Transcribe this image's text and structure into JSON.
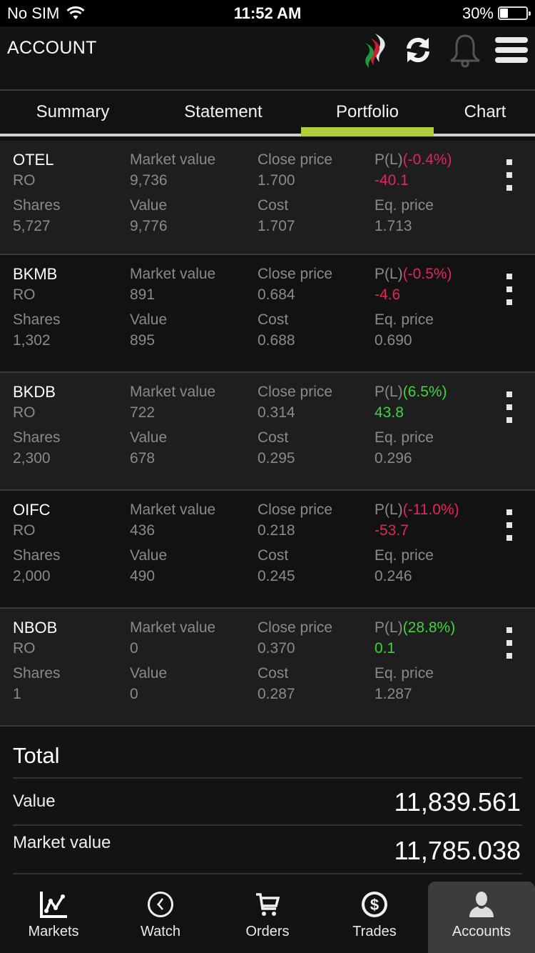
{
  "status_bar": {
    "carrier": "No SIM",
    "time": "11:52 AM",
    "battery_percent": "30%",
    "battery_level": 0.3
  },
  "header": {
    "title": "ACCOUNT",
    "icons": [
      "brand-logo-icon",
      "refresh-icon",
      "bell-icon",
      "hamburger-menu-icon"
    ]
  },
  "tabs": [
    {
      "label": "Summary",
      "active": false
    },
    {
      "label": "Statement",
      "active": false
    },
    {
      "label": "Portfolio",
      "active": true
    },
    {
      "label": "Chart",
      "active": false
    }
  ],
  "colors": {
    "accent": "#b2cb3a",
    "negative": "#e3245e",
    "positive": "#3ed43e",
    "label_grey": "#8a8a8a"
  },
  "labels": {
    "market_value": "Market value",
    "close_price": "Close price",
    "pl": "P(L)",
    "shares": "Shares",
    "value": "Value",
    "cost": "Cost",
    "eq_price": "Eq. price"
  },
  "holdings": [
    {
      "symbol": "OTEL",
      "currency": "RO",
      "market_value": "9,736",
      "close_price": "1.700",
      "pl_percent": "(-0.4%)",
      "pl_value": "-40.1",
      "trend": "neg",
      "shares": "5,727",
      "value": "9,776",
      "cost": "1.707",
      "eq_price": "1.713"
    },
    {
      "symbol": "BKMB",
      "currency": "RO",
      "market_value": "891",
      "close_price": "0.684",
      "pl_percent": "(-0.5%)",
      "pl_value": "-4.6",
      "trend": "neg",
      "shares": "1,302",
      "value": "895",
      "cost": "0.688",
      "eq_price": "0.690"
    },
    {
      "symbol": "BKDB",
      "currency": "RO",
      "market_value": "722",
      "close_price": "0.314",
      "pl_percent": "(6.5%)",
      "pl_value": "43.8",
      "trend": "pos",
      "shares": "2,300",
      "value": "678",
      "cost": "0.295",
      "eq_price": "0.296"
    },
    {
      "symbol": "OIFC",
      "currency": "RO",
      "market_value": "436",
      "close_price": "0.218",
      "pl_percent": "(-11.0%)",
      "pl_value": "-53.7",
      "trend": "neg",
      "shares": "2,000",
      "value": "490",
      "cost": "0.245",
      "eq_price": "0.246"
    },
    {
      "symbol": "NBOB",
      "currency": "RO",
      "market_value": "0",
      "close_price": "0.370",
      "pl_percent": "(28.8%)",
      "pl_value": "0.1",
      "trend": "pos",
      "shares": "1",
      "value": "0",
      "cost": "0.287",
      "eq_price": "1.287"
    }
  ],
  "total": {
    "heading": "Total",
    "value_label": "Value",
    "value": "11,839.561",
    "market_value_label": "Market value",
    "market_value": "11,785.038"
  },
  "bottom_nav": [
    {
      "label": "Markets",
      "icon": "line-chart-icon",
      "active": false
    },
    {
      "label": "Watch",
      "icon": "clock-icon",
      "active": false
    },
    {
      "label": "Orders",
      "icon": "cart-icon",
      "active": false
    },
    {
      "label": "Trades",
      "icon": "dollar-coin-icon",
      "active": false
    },
    {
      "label": "Accounts",
      "icon": "user-icon",
      "active": true
    }
  ]
}
